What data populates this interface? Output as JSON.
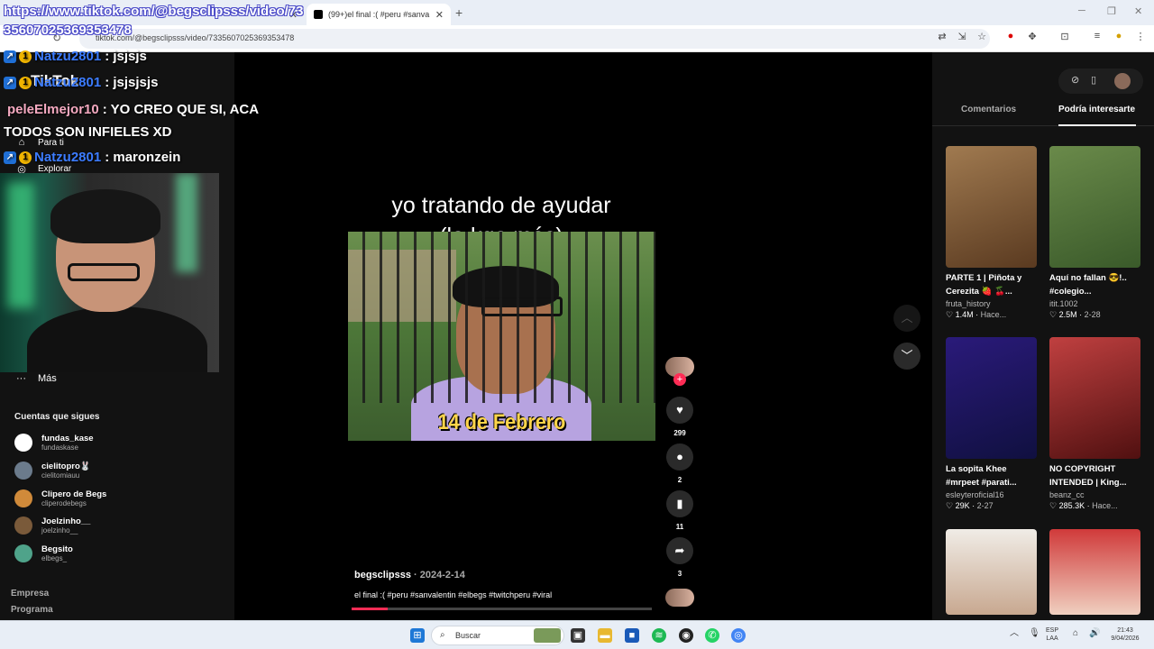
{
  "browser": {
    "tabs": [
      {
        "title": "",
        "active": false
      },
      {
        "title": "(99+)el final :( #peru #sanva",
        "active": true
      }
    ],
    "address": "tiktok.com/@begsclipsss/video/7335607025369353478"
  },
  "overlay": {
    "url_text": "https://www.tiktok.com/@begsclipsss/video/7335607025369353478",
    "chat": [
      {
        "user": "Natzu2801",
        "msg": ": jsjsjs",
        "color": "blue"
      },
      {
        "user": "Natzu2801",
        "msg": ": jsjsjsjs",
        "color": "blue"
      },
      {
        "user": "peleElmejor10",
        "msg": ": YO CREO QUE SI, ACA",
        "color": "pink"
      },
      {
        "user": "",
        "msg": "TODOS SON INFIELES XD",
        "color": "none"
      },
      {
        "user": "Natzu2801",
        "msg": ": maronzein",
        "color": "blue"
      }
    ]
  },
  "sidebar": {
    "brand": "TikTok",
    "nav": [
      {
        "label": "Para ti",
        "icon": "home-icon"
      },
      {
        "label": "Explorar",
        "icon": "compass-icon"
      }
    ],
    "more_label": "Más",
    "following_title": "Cuentas que sigues",
    "accounts": [
      {
        "name": "fundas_kase",
        "handle": "fundaskase",
        "color": "#ffffff"
      },
      {
        "name": "cielitopro🐰",
        "handle": "cielitomiauu",
        "color": "#6b7b8c"
      },
      {
        "name": "Clipero de Begs",
        "handle": "cliperodebegs",
        "color": "#d08a3a"
      },
      {
        "name": "Joelzinho__",
        "handle": "joelzinho__",
        "color": "#7a5a3a"
      },
      {
        "name": "Begsito",
        "handle": "elbegs_",
        "color": "#4fa38a"
      }
    ],
    "footer": [
      "Empresa",
      "Programa"
    ]
  },
  "video": {
    "caption_line1": "yo tratando de ayudar",
    "caption_line2": "(la kgo más)",
    "date_overlay": "14 de Febrero",
    "author": "begsclipsss",
    "date": "· 2024-2-14",
    "description": "el final :( #peru #sanvalentin #elbegs #twitchperu #viral",
    "progress": 0.12,
    "likes": "299",
    "comments": "2",
    "saves": "11",
    "shares": "3"
  },
  "right_panel": {
    "tabs": [
      "Comentarios",
      "Podría interesarte"
    ],
    "active_tab": 1,
    "cards": [
      {
        "title": "PARTE 1 | Piñota y Cerezita 🍓 🍒...",
        "author": "fruta_history",
        "views": "1.4M",
        "date": "Hace...",
        "thumb": "#7a5a3a"
      },
      {
        "title": "Aquí no fallan 😎!.. #colegio...",
        "author": "itit.1002",
        "views": "2.5M",
        "date": "2-28",
        "thumb": "#4d6b3a"
      },
      {
        "title": "La sopita Khee #mrpeet #parati...",
        "author": "esleyteroficial16",
        "views": "29K",
        "date": "2-27",
        "thumb": "#2a1a6a"
      },
      {
        "title": "NO COPYRIGHT INTENDED | King...",
        "author": "beanz_cc",
        "views": "285.3K",
        "date": "Hace...",
        "thumb": "#8a1a1a"
      },
      {
        "title": "",
        "author": "",
        "views": "",
        "date": "",
        "thumb": "#e6e0d8"
      },
      {
        "title": "",
        "author": "",
        "views": "",
        "date": "",
        "thumb": "#b83a3a"
      }
    ]
  },
  "taskbar": {
    "search_placeholder": "Buscar",
    "lang_line1": "ESP",
    "lang_line2": "LAA",
    "time": "21:43",
    "date": "9/04/2026"
  }
}
